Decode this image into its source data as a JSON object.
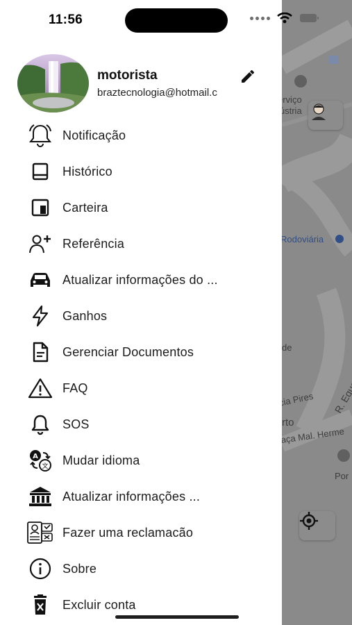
{
  "status_bar": {
    "time": "11:56"
  },
  "profile": {
    "name": "motorista",
    "email": "braztecnologia@hotmail.c"
  },
  "menu": [
    {
      "label": "Notificação",
      "icon": "bell-icon"
    },
    {
      "label": "Histórico",
      "icon": "book-icon"
    },
    {
      "label": "Carteira",
      "icon": "wallet-icon"
    },
    {
      "label": "Referência",
      "icon": "add-person-icon"
    },
    {
      "label": "Atualizar informações do ...",
      "icon": "car-icon"
    },
    {
      "label": "Ganhos",
      "icon": "lightning-icon"
    },
    {
      "label": "Gerenciar Documentos",
      "icon": "document-icon"
    },
    {
      "label": "FAQ",
      "icon": "warning-icon"
    },
    {
      "label": "SOS",
      "icon": "bell-outline-icon"
    },
    {
      "label": "Mudar idioma",
      "icon": "translate-icon"
    },
    {
      "label": "Atualizar informações ...",
      "icon": "bank-icon"
    },
    {
      "label": "Fazer uma reclamacão",
      "icon": "complaint-icon"
    },
    {
      "label": "Sobre",
      "icon": "info-icon"
    },
    {
      "label": "Excluir conta",
      "icon": "trash-icon"
    }
  ],
  "map": {
    "labels": {
      "servico": "erviço",
      "industria": "lústria",
      "rodoviaria": "Rodoviária",
      "de": "de",
      "pires": "ícia Pires",
      "equador": "R. Equador",
      "rto": "rto",
      "praca": "raça Mal. Herme",
      "por": "Por"
    }
  }
}
